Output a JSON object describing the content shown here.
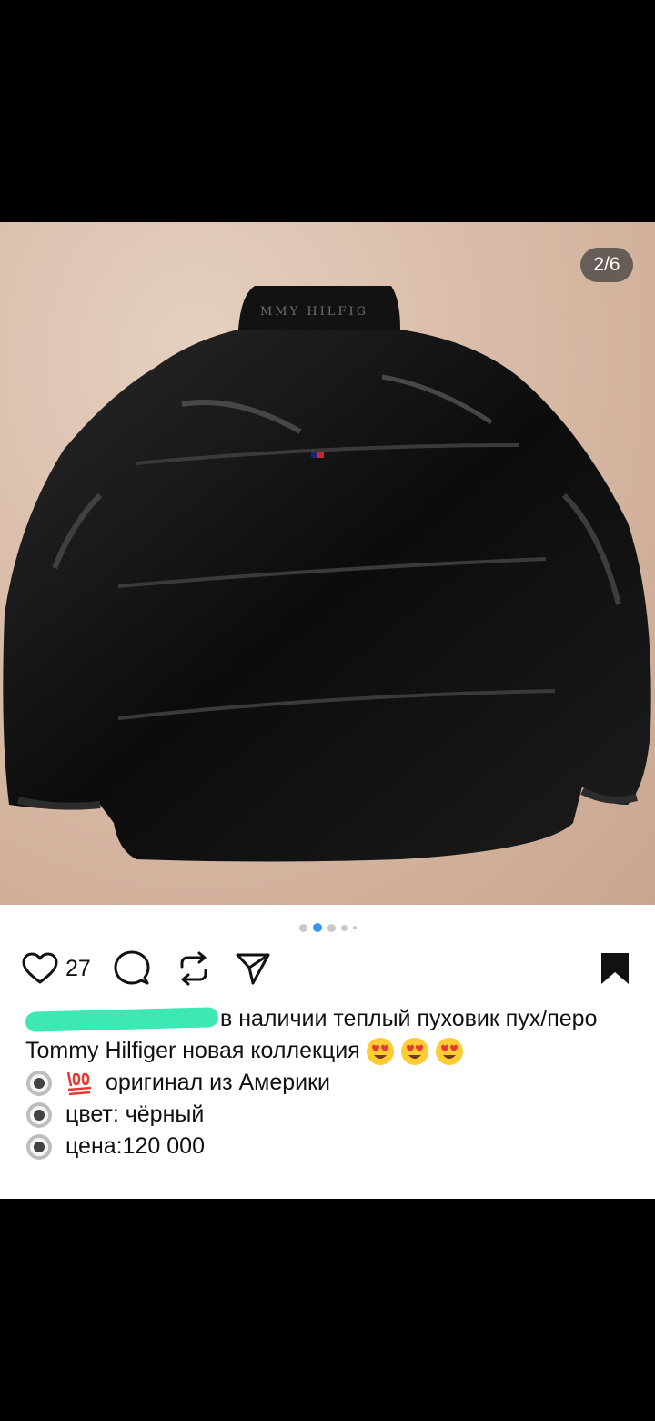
{
  "photo": {
    "counter": "2/6",
    "brand_text": "MMY HILFIG"
  },
  "carousel": {
    "total": 5,
    "active_index": 1
  },
  "actions": {
    "like_count": "27",
    "icons": [
      "heart-icon",
      "comment-icon",
      "repost-icon",
      "share-icon",
      "bookmark-icon"
    ]
  },
  "caption": {
    "line1_text": "в наличии теплый пуховик пух/перо",
    "line2_text": "Tommy Hilfiger новая коллекция",
    "line3_text": "оригинал из Америки",
    "line4_text": "цвет: чёрный",
    "line5_text": "цена:120 000"
  },
  "colors": {
    "accent": "#3897f0",
    "redaction": "#3ee8b4"
  }
}
